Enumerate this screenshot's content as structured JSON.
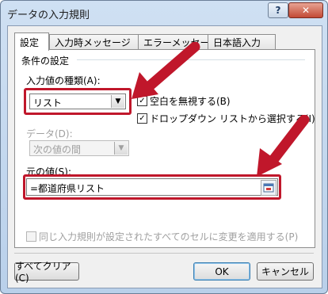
{
  "window": {
    "title": "データの入力規則",
    "help_label": "?",
    "close_label": "✕"
  },
  "tabs": [
    {
      "label": "設定",
      "active": true
    },
    {
      "label": "入力時メッセージ",
      "active": false
    },
    {
      "label": "エラーメッセージ",
      "active": false
    },
    {
      "label": "日本語入力",
      "active": false
    }
  ],
  "criteria": {
    "group_label": "条件の設定",
    "allow_label": "入力値の種類(A):",
    "allow_value": "リスト",
    "data_label": "データ(D):",
    "data_value": "次の値の間",
    "ignore_blank_label": "空白を無視する(B)",
    "ignore_blank_checked": true,
    "in_cell_dropdown_label": "ドロップダウン リストから選択する(I)",
    "in_cell_dropdown_checked": true,
    "source_label": "元の値(S):",
    "source_value": "=都道府県リスト"
  },
  "apply_all": {
    "label": "同じ入力規則が設定されたすべてのセルに変更を適用する(P)",
    "checked": false
  },
  "buttons": {
    "clear_all": "すべてクリア(C)",
    "ok": "OK",
    "cancel": "キャンセル"
  },
  "colors": {
    "highlight": "#c0172b",
    "title_bar": "#c4d8ef",
    "dialog_bg": "#f0f0f0"
  }
}
